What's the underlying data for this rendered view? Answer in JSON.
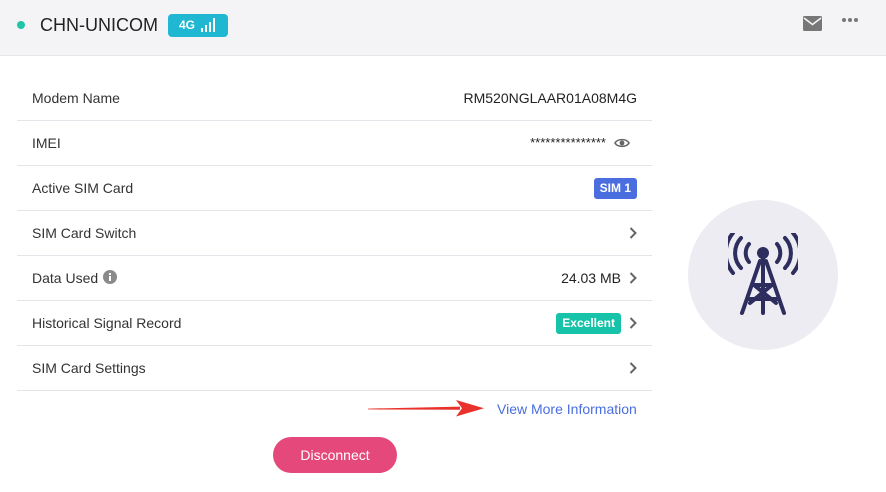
{
  "header": {
    "carrier": "CHN-UNICOM",
    "network_type": "4G",
    "status_color": "#20c4a7",
    "badge_color": "#1fb7d2",
    "icons": [
      "signal-bars-icon",
      "mail-icon",
      "more-icon"
    ]
  },
  "rows": [
    {
      "label": "Modem Name",
      "value": "RM520NGLAAR01A08M4G"
    },
    {
      "label": "IMEI",
      "value": "***************"
    },
    {
      "label": "Active SIM Card",
      "value": "SIM 1"
    },
    {
      "label": "SIM Card Switch"
    },
    {
      "label": "Data Used",
      "value": "24.03 MB"
    },
    {
      "label": "Historical Signal Record",
      "value": "Excellent"
    },
    {
      "label": "SIM Card Settings"
    }
  ],
  "view_more": "View More Information",
  "disconnect_label": "Disconnect",
  "colors": {
    "sim_badge": "#4a6ee0",
    "excellent_badge": "#16c3a9",
    "disconnect": "#e5497b",
    "link": "#4a6ee0",
    "annotation_arrow": "#e8322b"
  }
}
